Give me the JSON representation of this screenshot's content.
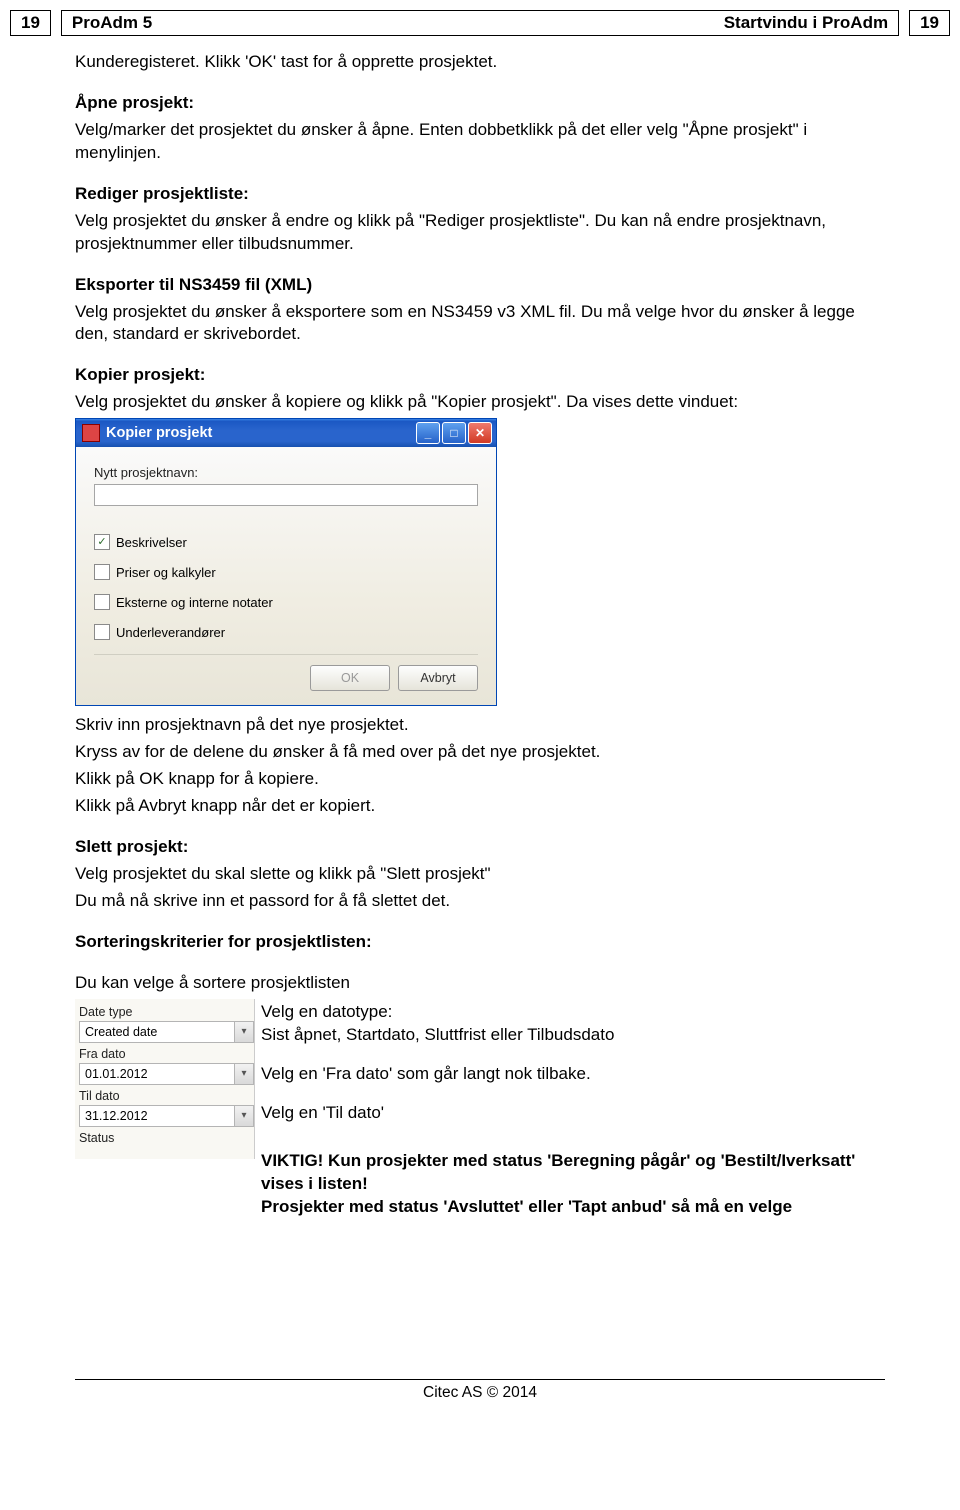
{
  "header": {
    "page_left": "19",
    "app_name": "ProAdm 5",
    "section_title": "Startvindu i ProAdm",
    "page_right": "19"
  },
  "body": {
    "line1": "Kunderegisteret. Klikk 'OK' tast for å opprette prosjektet.",
    "open_heading": "Åpne prosjekt:",
    "open_text": "Velg/marker det prosjektet du ønsker å åpne. Enten dobbetklikk på det eller velg \"Åpne prosjekt\" i menylinjen.",
    "edit_heading": "Rediger prosjektliste:",
    "edit_text": "Velg prosjektet du ønsker å endre og klikk på \"Rediger prosjektliste\". Du kan nå endre prosjektnavn, prosjektnummer eller tilbudsnummer.",
    "export_heading": "Eksporter til NS3459 fil (XML)",
    "export_text": "Velg prosjektet du ønsker å eksportere som en NS3459 v3 XML fil. Du må velge hvor du ønsker å legge den, standard er skrivebordet.",
    "copy_heading": "Kopier prosjekt:",
    "copy_text": "Velg prosjektet du ønsker å kopiere og klikk på \"Kopier prosjekt\". Da vises dette vinduet:",
    "after_dialog": [
      "Skriv inn prosjektnavn på det nye prosjektet.",
      "Kryss av for de delene du ønsker å få med over på det nye prosjektet.",
      "Klikk på OK knapp for å kopiere.",
      "Klikk på Avbryt knapp når det er kopiert."
    ],
    "delete_heading": "Slett prosjekt:",
    "delete_lines": [
      "Velg prosjektet du skal slette og klikk på \"Slett prosjekt\"",
      "Du må nå skrive inn et passord for å få slettet det."
    ],
    "sort_heading": "Sorteringskriterier for prosjektlisten:",
    "sort_intro": "Du kan velge å sortere prosjektlisten"
  },
  "dialog": {
    "title": "Kopier prosjekt",
    "field_label": "Nytt prosjektnavn:",
    "field_value": "",
    "checks": [
      {
        "label": "Beskrivelser",
        "checked": true
      },
      {
        "label": "Priser og kalkyler",
        "checked": false
      },
      {
        "label": "Eksterne og interne notater",
        "checked": false
      },
      {
        "label": "Underleverandører",
        "checked": false
      }
    ],
    "ok": "OK",
    "cancel": "Avbryt"
  },
  "filters": {
    "label_datetype": "Date type",
    "value_datetype": "Created date",
    "label_from": "Fra dato",
    "value_from": "01.01.2012",
    "label_to": "Til dato",
    "value_to": "31.12.2012",
    "label_status": "Status",
    "value_status": ""
  },
  "rside": {
    "l1": "Velg en datotype:",
    "l2": "Sist åpnet, Startdato, Sluttfrist eller Tilbudsdato",
    "l3": "Velg en 'Fra dato' som går langt nok tilbake.",
    "l4": "Velg en 'Til dato'",
    "l5a": "VIKTIG! Kun prosjekter med status 'Beregning pågår' og 'Bestilt/Iverksatt' vises i listen!",
    "l5b": "Prosjekter med status 'Avsluttet' eller 'Tapt anbud' så må en velge"
  },
  "footer": "Citec AS © 2014"
}
